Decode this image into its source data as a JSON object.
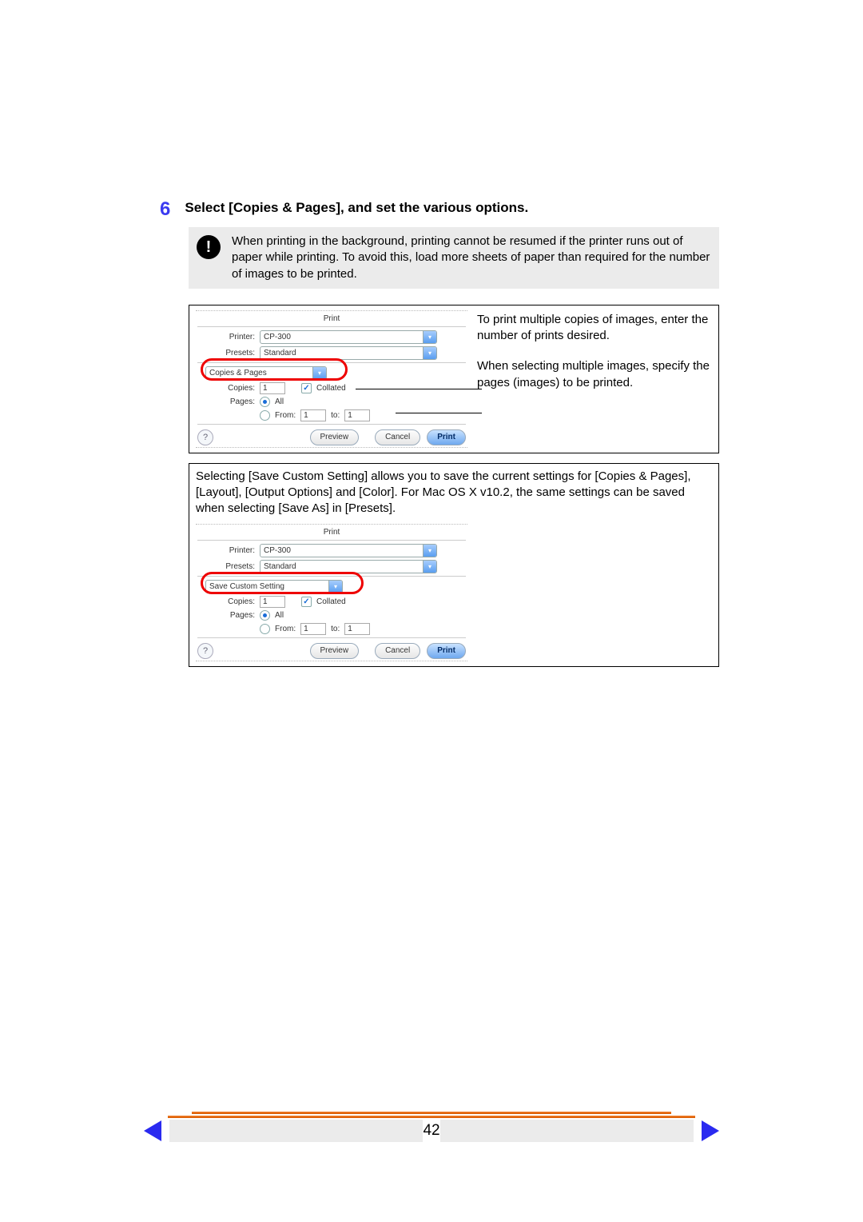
{
  "step": {
    "number": "6",
    "title": "Select [Copies & Pages], and set the various options."
  },
  "note": "When printing in the background, printing cannot be resumed if the printer runs out of paper while printing. To avoid this, load more sheets of paper than required for the number of images to be printed.",
  "callout_copies": "To print multiple copies of images, enter the number of prints desired.",
  "callout_pages": "When selecting multiple images, specify the pages (images) to be printed.",
  "dialog1": {
    "title": "Print",
    "printer_label": "Printer:",
    "printer_value": "CP-300",
    "presets_label": "Presets:",
    "presets_value": "Standard",
    "section_value": "Copies & Pages",
    "copies_label": "Copies:",
    "copies_value": "1",
    "collated_label": "Collated",
    "pages_label": "Pages:",
    "pages_all": "All",
    "pages_from_label": "From:",
    "pages_from_value": "1",
    "pages_to_label": "to:",
    "pages_to_value": "1",
    "btn_preview": "Preview",
    "btn_cancel": "Cancel",
    "btn_print": "Print"
  },
  "frame2_text": "Selecting [Save Custom Setting] allows you to save the current settings for [Copies & Pages], [Layout], [Output Options] and [Color]. For Mac OS X v10.2, the same settings can be saved when selecting [Save As] in [Presets].",
  "dialog2": {
    "title": "Print",
    "printer_label": "Printer:",
    "printer_value": "CP-300",
    "presets_label": "Presets:",
    "presets_value": "Standard",
    "section_value": "Save Custom Setting",
    "copies_label": "Copies:",
    "copies_value": "1",
    "collated_label": "Collated",
    "pages_label": "Pages:",
    "pages_all": "All",
    "pages_from_label": "From:",
    "pages_from_value": "1",
    "pages_to_label": "to:",
    "pages_to_value": "1",
    "btn_preview": "Preview",
    "btn_cancel": "Cancel",
    "btn_print": "Print"
  },
  "page_number": "42"
}
